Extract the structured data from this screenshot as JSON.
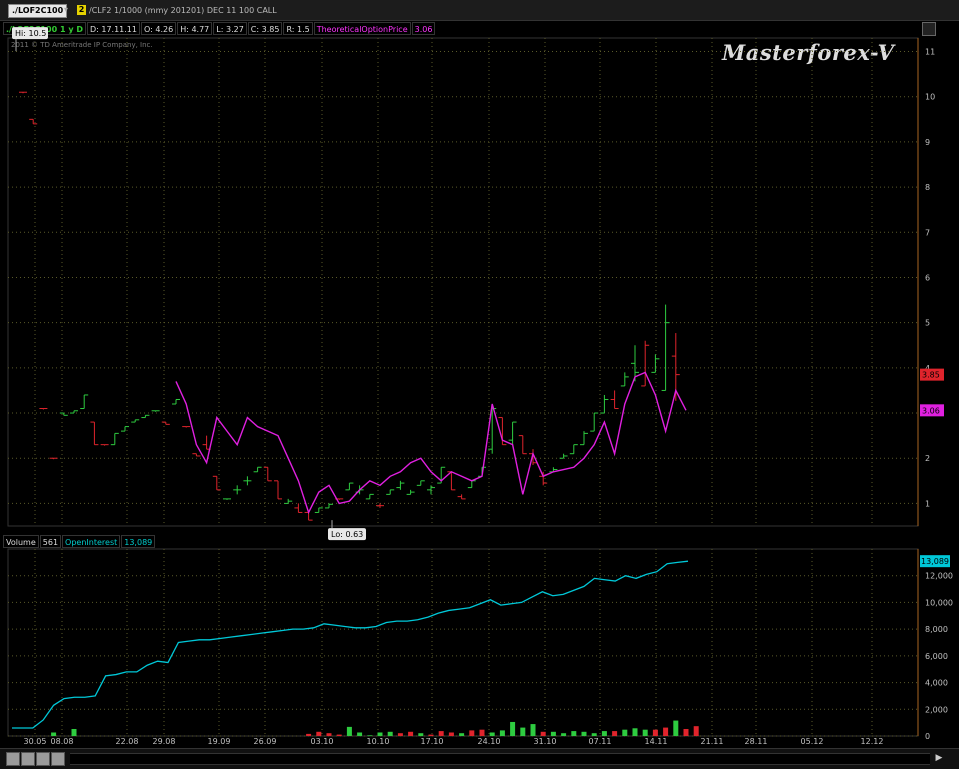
{
  "toolbar": {
    "symbol": "./LOF2C100",
    "link_badge": "2",
    "description": "/CLF2 1/1000 (mmy 201201) DEC 11 100 CALL"
  },
  "legend": {
    "symbol_label": "./LOF2C100 1 y D",
    "date": "D: 17.11.11",
    "open": "O: 4.26",
    "high": "H: 4.77",
    "low": "L: 3.27",
    "close": "C: 3.85",
    "range": "R: 1.5",
    "study_name": "TheoreticalOptionPrice",
    "study_value": "3.06"
  },
  "copyright": "2011 © TD Ameritrade IP Company, Inc.",
  "watermark": "Masterforex-V",
  "volume_legend": {
    "volume_label": "Volume",
    "volume_value": "561",
    "oi_label": "OpenInterest",
    "oi_value": "13,089"
  },
  "colors": {
    "up": "#2ecc40",
    "down": "#e0242c",
    "theoretical": "#e020e0",
    "open_interest": "#00c8d8",
    "grid": "#5a5a2a",
    "axis_text": "#c0c0c0"
  },
  "chart_data": [
    {
      "type": "ohlc",
      "title": "./LOF2C100 1 y D",
      "ylim": [
        0.5,
        11.3
      ],
      "y_ticks": [
        "1",
        "2",
        "3",
        "4",
        "5",
        "6",
        "7",
        "8",
        "9",
        "10",
        "11"
      ],
      "hi_label": "Hi: 10.5",
      "lo_label": "Lo: 0.63",
      "last_price_label": "3.85",
      "theoretical_label": "3.06",
      "bars": [
        [
          10.1,
          10.1,
          10.1,
          10.1,
          "down"
        ],
        [
          9.5,
          9.5,
          9.4,
          9.4,
          "down"
        ],
        [
          3.1,
          3.1,
          3.1,
          3.1,
          "down"
        ],
        [
          2.0,
          2.0,
          2.0,
          2.0,
          "down"
        ],
        [
          3.0,
          3.0,
          2.95,
          2.95,
          "up"
        ],
        [
          3.0,
          3.05,
          3.0,
          3.05,
          "up"
        ],
        [
          3.1,
          3.4,
          3.1,
          3.4,
          "up"
        ],
        [
          2.8,
          2.8,
          2.3,
          2.3,
          "down"
        ],
        [
          2.3,
          2.3,
          2.3,
          2.3,
          "down"
        ],
        [
          2.3,
          2.55,
          2.3,
          2.55,
          "up"
        ],
        [
          2.6,
          2.7,
          2.6,
          2.7,
          "up"
        ],
        [
          2.8,
          2.85,
          2.8,
          2.85,
          "up"
        ],
        [
          2.9,
          2.95,
          2.9,
          2.95,
          "up"
        ],
        [
          3.05,
          3.05,
          3.05,
          3.05,
          "up"
        ],
        [
          2.8,
          2.8,
          2.75,
          2.75,
          "down"
        ],
        [
          3.2,
          3.3,
          3.2,
          3.3,
          "up"
        ],
        [
          2.7,
          2.7,
          2.7,
          2.7,
          "down"
        ],
        [
          2.1,
          2.1,
          2.05,
          2.05,
          "down"
        ],
        [
          2.3,
          2.5,
          2.2,
          2.2,
          "down"
        ],
        [
          1.6,
          1.6,
          1.3,
          1.3,
          "down"
        ],
        [
          1.1,
          1.1,
          1.1,
          1.1,
          "up"
        ],
        [
          1.3,
          1.4,
          1.2,
          1.3,
          "up"
        ],
        [
          1.5,
          1.6,
          1.4,
          1.5,
          "up"
        ],
        [
          1.7,
          1.8,
          1.7,
          1.8,
          "up"
        ],
        [
          1.8,
          1.8,
          1.5,
          1.5,
          "down"
        ],
        [
          1.5,
          1.5,
          1.1,
          1.1,
          "down"
        ],
        [
          1.0,
          1.1,
          1.0,
          1.05,
          "up"
        ],
        [
          0.9,
          1.0,
          0.8,
          0.8,
          "down"
        ],
        [
          0.8,
          0.8,
          0.63,
          0.63,
          "down"
        ],
        [
          0.8,
          0.9,
          0.8,
          0.9,
          "up"
        ],
        [
          0.9,
          1.0,
          0.9,
          0.98,
          "up"
        ],
        [
          1.1,
          1.1,
          1.1,
          1.1,
          "down"
        ],
        [
          1.3,
          1.45,
          1.3,
          1.45,
          "up"
        ],
        [
          1.25,
          1.4,
          1.2,
          1.3,
          "up"
        ],
        [
          1.1,
          1.2,
          1.1,
          1.2,
          "up"
        ],
        [
          0.95,
          1.0,
          0.9,
          0.95,
          "down"
        ],
        [
          1.2,
          1.3,
          1.2,
          1.3,
          "up"
        ],
        [
          1.35,
          1.5,
          1.3,
          1.45,
          "up"
        ],
        [
          1.2,
          1.3,
          1.2,
          1.25,
          "up"
        ],
        [
          1.4,
          1.5,
          1.4,
          1.5,
          "up"
        ],
        [
          1.3,
          1.4,
          1.2,
          1.35,
          "up"
        ],
        [
          1.45,
          1.8,
          1.45,
          1.8,
          "up"
        ],
        [
          1.7,
          1.7,
          1.3,
          1.3,
          "down"
        ],
        [
          1.15,
          1.2,
          1.1,
          1.1,
          "down"
        ],
        [
          1.35,
          1.5,
          1.35,
          1.5,
          "up"
        ],
        [
          1.6,
          1.8,
          1.6,
          1.8,
          "up"
        ],
        [
          2.2,
          3.2,
          2.1,
          3.1,
          "up"
        ],
        [
          2.9,
          2.9,
          2.3,
          2.3,
          "down"
        ],
        [
          2.4,
          2.8,
          2.3,
          2.8,
          "up"
        ],
        [
          2.5,
          2.5,
          2.1,
          2.1,
          "down"
        ],
        [
          2.1,
          2.2,
          1.85,
          1.9,
          "down"
        ],
        [
          1.6,
          1.7,
          1.4,
          1.45,
          "down"
        ],
        [
          1.7,
          1.8,
          1.7,
          1.75,
          "up"
        ],
        [
          2.0,
          2.1,
          2.0,
          2.05,
          "up"
        ],
        [
          2.1,
          2.3,
          2.1,
          2.3,
          "up"
        ],
        [
          2.3,
          2.6,
          2.3,
          2.55,
          "up"
        ],
        [
          2.6,
          3.0,
          2.6,
          3.0,
          "up"
        ],
        [
          3.0,
          3.4,
          3.0,
          3.3,
          "up"
        ],
        [
          3.3,
          3.5,
          3.1,
          3.1,
          "down"
        ],
        [
          3.6,
          3.9,
          3.6,
          3.8,
          "up"
        ],
        [
          4.1,
          4.5,
          3.7,
          3.9,
          "up"
        ],
        [
          3.6,
          4.6,
          3.6,
          4.5,
          "down"
        ],
        [
          3.9,
          4.3,
          3.9,
          4.2,
          "up"
        ],
        [
          3.5,
          5.4,
          3.5,
          5.0,
          "up"
        ],
        [
          4.26,
          4.77,
          3.27,
          3.85,
          "down"
        ]
      ],
      "series": [
        {
          "name": "TheoreticalOptionPrice",
          "values": [
            null,
            null,
            null,
            null,
            null,
            null,
            null,
            null,
            null,
            null,
            null,
            null,
            null,
            null,
            null,
            3.7,
            3.2,
            2.3,
            1.9,
            2.9,
            2.6,
            2.3,
            2.9,
            2.7,
            2.6,
            2.5,
            2.0,
            1.5,
            0.8,
            1.25,
            1.4,
            1.0,
            1.05,
            1.3,
            1.5,
            1.4,
            1.6,
            1.7,
            1.9,
            2.0,
            1.7,
            1.5,
            1.7,
            1.6,
            1.5,
            1.6,
            3.2,
            2.4,
            2.3,
            1.2,
            2.1,
            1.6,
            1.7,
            1.75,
            1.8,
            2.0,
            2.3,
            2.8,
            2.1,
            3.2,
            3.8,
            3.9,
            3.4,
            2.6,
            3.5,
            3.06
          ]
        }
      ]
    },
    {
      "type": "bar_line",
      "x_ticks": [
        "30.05",
        "08.08",
        "22.08",
        "29.08",
        "19.09",
        "26.09",
        "03.10",
        "10.10",
        "17.10",
        "24.10",
        "31.10",
        "07.11",
        "14.11",
        "21.11",
        "28.11",
        "05.12",
        "12.12"
      ],
      "ylim": [
        0,
        14000
      ],
      "y_ticks": [
        "0",
        "2,000",
        "4,000",
        "6,000",
        "8,000",
        "10,000",
        "12,000"
      ],
      "oi_label": "13,089",
      "open_interest": [
        600,
        600,
        600,
        1200,
        2300,
        2800,
        2900,
        2900,
        3000,
        4500,
        4600,
        4800,
        4800,
        5300,
        5600,
        5500,
        7000,
        7100,
        7200,
        7200,
        7300,
        7400,
        7500,
        7600,
        7700,
        7800,
        7900,
        8000,
        8000,
        8100,
        8400,
        8300,
        8200,
        8100,
        8100,
        8200,
        8500,
        8600,
        8600,
        8700,
        8900,
        9200,
        9400,
        9500,
        9600,
        9900,
        10200,
        9800,
        9900,
        10000,
        10400,
        10800,
        10500,
        10600,
        10900,
        11200,
        11800,
        11700,
        11600,
        12000,
        11800,
        12100,
        12300,
        12900,
        13000,
        13089
      ],
      "volume": [
        [
          0,
          "up"
        ],
        [
          0,
          "down"
        ],
        [
          0,
          "down"
        ],
        [
          250,
          "up"
        ],
        [
          0,
          "down"
        ],
        [
          500,
          "up"
        ],
        [
          0,
          "down"
        ],
        [
          0,
          "down"
        ],
        [
          0,
          "down"
        ],
        [
          0,
          "down"
        ],
        [
          0,
          "down"
        ],
        [
          0,
          "down"
        ],
        [
          0,
          "down"
        ],
        [
          0,
          "down"
        ],
        [
          0,
          "down"
        ],
        [
          0,
          "down"
        ],
        [
          0,
          "down"
        ],
        [
          0,
          "down"
        ],
        [
          0,
          "down"
        ],
        [
          0,
          "down"
        ],
        [
          0,
          "down"
        ],
        [
          0,
          "down"
        ],
        [
          0,
          "down"
        ],
        [
          0,
          "down"
        ],
        [
          0,
          "down"
        ],
        [
          0,
          "down"
        ],
        [
          0,
          "down"
        ],
        [
          0,
          "down"
        ],
        [
          150,
          "down"
        ],
        [
          300,
          "down"
        ],
        [
          200,
          "down"
        ],
        [
          100,
          "down"
        ],
        [
          650,
          "up"
        ],
        [
          250,
          "up"
        ],
        [
          50,
          "up"
        ],
        [
          250,
          "up"
        ],
        [
          300,
          "up"
        ],
        [
          200,
          "down"
        ],
        [
          300,
          "down"
        ],
        [
          200,
          "up"
        ],
        [
          100,
          "down"
        ],
        [
          350,
          "down"
        ],
        [
          250,
          "down"
        ],
        [
          200,
          "up"
        ],
        [
          400,
          "down"
        ],
        [
          450,
          "down"
        ],
        [
          250,
          "up"
        ],
        [
          400,
          "up"
        ],
        [
          1000,
          "up"
        ],
        [
          600,
          "up"
        ],
        [
          850,
          "up"
        ],
        [
          300,
          "down"
        ],
        [
          300,
          "up"
        ],
        [
          200,
          "up"
        ],
        [
          350,
          "up"
        ],
        [
          300,
          "up"
        ],
        [
          200,
          "up"
        ],
        [
          350,
          "up"
        ],
        [
          350,
          "down"
        ],
        [
          450,
          "up"
        ],
        [
          550,
          "up"
        ],
        [
          450,
          "up"
        ],
        [
          450,
          "down"
        ],
        [
          600,
          "down"
        ],
        [
          1100,
          "up"
        ],
        [
          500,
          "down"
        ],
        [
          700,
          "down"
        ]
      ]
    }
  ]
}
